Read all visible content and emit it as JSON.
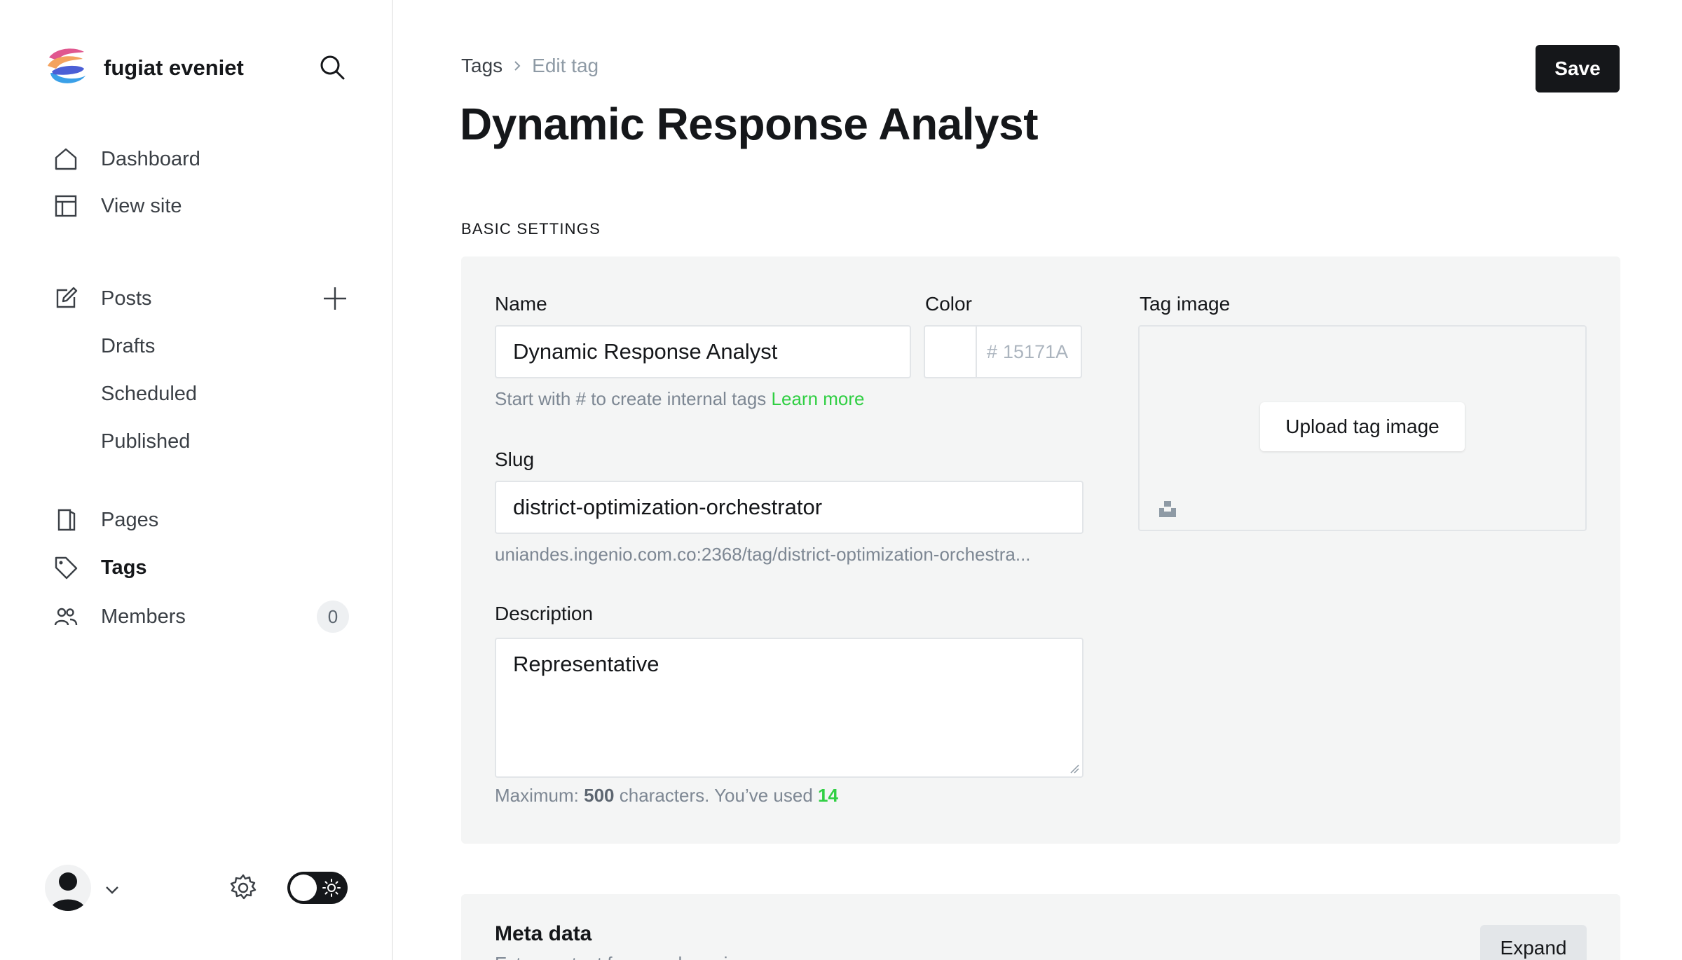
{
  "sidebar": {
    "site_name": "fugiat eveniet",
    "nav_primary": [
      {
        "label": "Dashboard",
        "icon": "home-icon"
      },
      {
        "label": "View site",
        "icon": "layout-icon"
      }
    ],
    "posts": {
      "label": "Posts",
      "icon": "edit-icon",
      "sub_items": [
        "Drafts",
        "Scheduled",
        "Published"
      ]
    },
    "nav_secondary": [
      {
        "label": "Pages",
        "icon": "page-icon"
      },
      {
        "label": "Tags",
        "icon": "tag-icon",
        "active": true
      },
      {
        "label": "Members",
        "icon": "members-icon",
        "badge": "0"
      }
    ]
  },
  "breadcrumb": {
    "parent": "Tags",
    "current": "Edit tag"
  },
  "page_title": "Dynamic Response Analyst",
  "toolbar": {
    "save_label": "Save"
  },
  "basic_settings": {
    "heading": "Basic settings",
    "name": {
      "label": "Name",
      "value": "Dynamic Response Analyst",
      "help": "Start with # to create internal tags",
      "help_link": "Learn more"
    },
    "color": {
      "label": "Color",
      "hash": "#",
      "placeholder": "15171A"
    },
    "tag_image": {
      "label": "Tag image",
      "upload_label": "Upload tag image"
    },
    "slug": {
      "label": "Slug",
      "value": "district-optimization-orchestrator",
      "url_preview": "uniandes.ingenio.com.co:2368/tag/district-optimization-orchestra..."
    },
    "description": {
      "label": "Description",
      "value": "Representative",
      "help_prefix": "Maximum: ",
      "max": "500",
      "help_middle": " characters. You’ve used ",
      "used": "14"
    }
  },
  "meta_data": {
    "title": "Meta data",
    "subtitle": "Extra content for search engines",
    "expand_label": "Expand"
  },
  "colors": {
    "accent_green": "#30cf43",
    "dark": "#15171a",
    "panel_bg": "#f4f5f5"
  }
}
